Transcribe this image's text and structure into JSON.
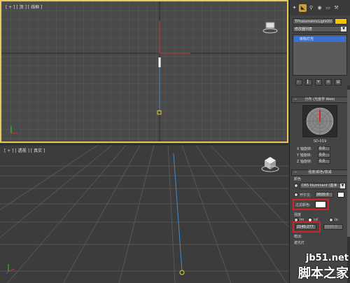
{
  "viewports": {
    "top": {
      "label": "[ + ] [ 顶 ] [ 线框 ]"
    },
    "perspective": {
      "label": "[ + ] [ 透视 ] [ 真实 ]"
    }
  },
  "command_panel": {
    "tabs": [
      "create-icon",
      "modify-icon",
      "hierarchy-icon",
      "motion-icon",
      "display-icon",
      "utilities-icon"
    ],
    "object_name": "TPhotometricLight001",
    "object_color": "#f5c400",
    "modifier_list": "修改器列表",
    "stack_item": "目标灯光",
    "distribution": {
      "header": "分布 (光度学 Web)",
      "web_name": "SD-019",
      "x_rotation_label": "X 轴旋转:",
      "x_rotation": "0.0",
      "y_rotation_label": "Y 轴旋转:",
      "y_rotation": "0.0",
      "z_rotation_label": "Z 轴旋转:",
      "z_rotation": "0.0"
    },
    "intensity": {
      "header": "强度/颜色/衰减",
      "color_label": "颜色",
      "preset": "D65 Illuminant (基准",
      "kelvin_label": "开尔文:",
      "kelvin_value": "3600.0",
      "filter_color_label": "过滤颜色:",
      "strength_label": "强度",
      "lm_label": "lm",
      "cd_label": "cd",
      "lx_label": "lx:",
      "cd_value": "2140.277",
      "lx_value": "1000.0",
      "dimming_label": "暗淡:",
      "incandescent_label": "遮光灯"
    }
  },
  "watermark": {
    "site": "jb51.net",
    "name": "脚本之家"
  },
  "colors": {
    "highlight_red": "#d0232a",
    "viewport_active_border": "#e6c95a",
    "selected_item": "#3b6fd0"
  }
}
